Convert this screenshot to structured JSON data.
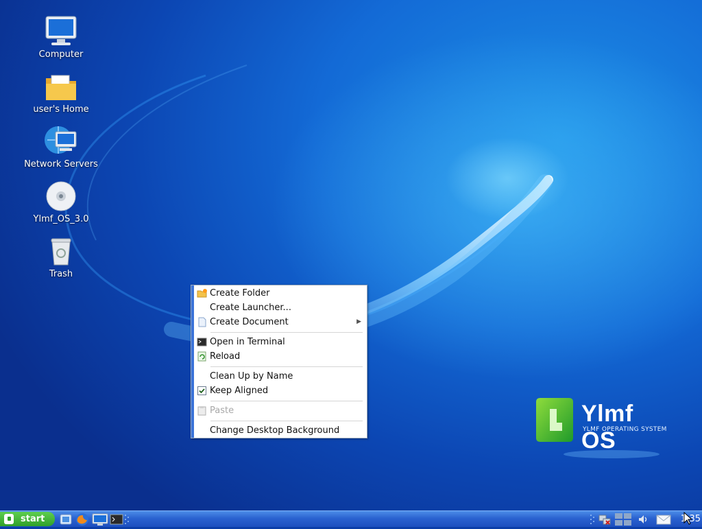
{
  "desktop_icons": [
    {
      "label": "Computer",
      "icon": "computer-icon"
    },
    {
      "label": "user's Home",
      "icon": "folder-icon"
    },
    {
      "label": "Network Servers",
      "icon": "network-icon"
    },
    {
      "label": "Ylmf_OS_3.0",
      "icon": "cdrom-icon"
    },
    {
      "label": "Trash",
      "icon": "trash-icon"
    }
  ],
  "context_menu": {
    "create_folder": "Create Folder",
    "create_launcher": "Create Launcher...",
    "create_document": "Create Document",
    "open_terminal": "Open in Terminal",
    "reload": "Reload",
    "clean_up": "Clean Up by Name",
    "keep_aligned": "Keep Aligned",
    "keep_aligned_checked": true,
    "paste": "Paste",
    "change_background": "Change Desktop Background"
  },
  "branding": {
    "name": "Ylmf OS",
    "tagline": "YLMF OPERATING SYSTEM"
  },
  "taskbar": {
    "start_label": "start",
    "clock": "1:35"
  },
  "colors": {
    "accent": "#3c74d8",
    "brand_green": "#3fae2a"
  }
}
